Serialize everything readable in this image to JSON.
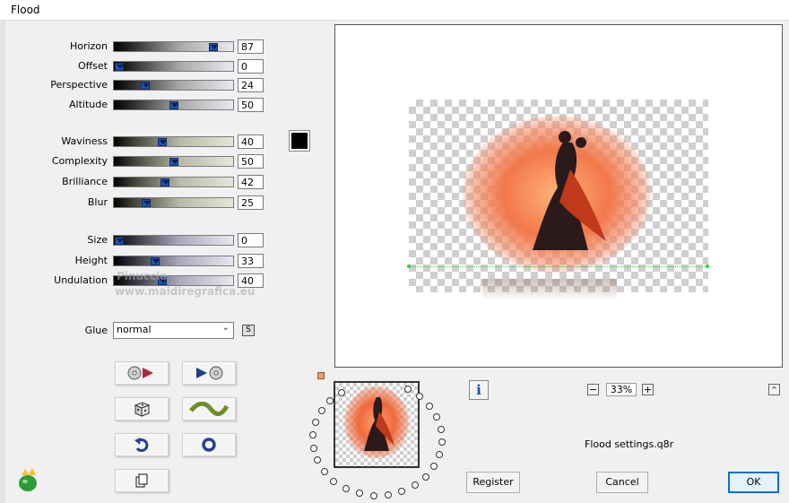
{
  "window": {
    "title": "Flood"
  },
  "sliders": [
    {
      "key": "horizon",
      "label": "Horizon",
      "value": "87",
      "percent": 87
    },
    {
      "key": "offset",
      "label": "Offset",
      "value": "0",
      "percent": 0
    },
    {
      "key": "perspective",
      "label": "Perspective",
      "value": "24",
      "percent": 24
    },
    {
      "key": "altitude",
      "label": "Altitude",
      "value": "50",
      "percent": 50
    },
    {
      "key": "waviness",
      "label": "Waviness",
      "value": "40",
      "percent": 40
    },
    {
      "key": "complexity",
      "label": "Complexity",
      "value": "50",
      "percent": 50
    },
    {
      "key": "brilliance",
      "label": "Brilliance",
      "value": "42",
      "percent": 42
    },
    {
      "key": "blur",
      "label": "Blur",
      "value": "25",
      "percent": 25
    },
    {
      "key": "size",
      "label": "Size",
      "value": "0",
      "percent": 0
    },
    {
      "key": "height",
      "label": "Height",
      "value": "33",
      "percent": 33
    },
    {
      "key": "undulation",
      "label": "Undulation",
      "value": "40",
      "percent": 40
    }
  ],
  "color_swatch": {
    "color": "#000000"
  },
  "glue": {
    "label": "Glue",
    "value": "normal",
    "sync_icon": "S"
  },
  "icon_buttons": [
    {
      "name": "load-preset-icon",
      "glyph": "◎▶"
    },
    {
      "name": "save-preset-icon",
      "glyph": "▶◎"
    },
    {
      "name": "randomize-icon",
      "glyph": "🎲"
    },
    {
      "name": "wave-icon",
      "glyph": "∿"
    },
    {
      "name": "undo-icon",
      "glyph": "↶"
    },
    {
      "name": "reset-icon",
      "glyph": "◉"
    },
    {
      "name": "copy-icon",
      "glyph": "❐"
    }
  ],
  "preview": {
    "zoom": "33%"
  },
  "settings_file": "Flood settings.q8r",
  "watermark": {
    "line1": "Pinuccia",
    "line2": "www.maidiregrafica.eu"
  },
  "buttons": {
    "register": "Register",
    "cancel": "Cancel",
    "ok": "OK"
  },
  "info_icon": "i",
  "zoom_minus": "−",
  "zoom_plus": "+",
  "scroll_up_icon": "^"
}
